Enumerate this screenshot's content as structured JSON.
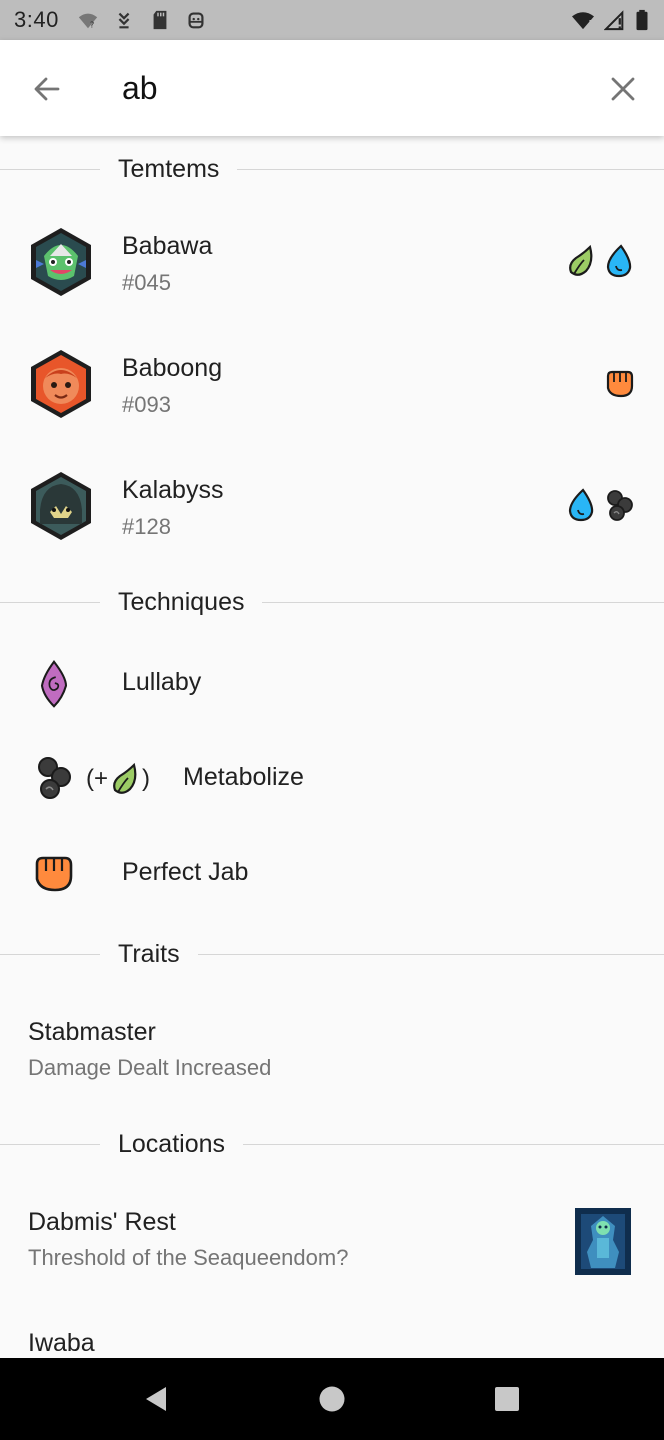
{
  "status_bar": {
    "time": "3:40"
  },
  "search": {
    "query": "ab",
    "back_icon": "arrow-left-icon",
    "clear_icon": "close-icon"
  },
  "sections": {
    "temtems": {
      "title": "Temtems"
    },
    "techniques": {
      "title": "Techniques"
    },
    "traits": {
      "title": "Traits"
    },
    "locations": {
      "title": "Locations"
    }
  },
  "temtems": [
    {
      "name": "Babawa",
      "number": "#045",
      "types": [
        "nature",
        "water"
      ],
      "avatar_color": "#3fae5a"
    },
    {
      "name": "Baboong",
      "number": "#093",
      "types": [
        "melee"
      ],
      "avatar_color": "#e8562a"
    },
    {
      "name": "Kalabyss",
      "number": "#128",
      "types": [
        "water",
        "toxic"
      ],
      "avatar_color": "#2d4a4a"
    }
  ],
  "techniques": [
    {
      "name": "Lullaby",
      "type": "mental"
    },
    {
      "name": "Metabolize",
      "type": "toxic",
      "synergy_open": "(+",
      "synergy_close": ")",
      "synergy_type": "nature"
    },
    {
      "name": "Perfect Jab",
      "type": "melee"
    }
  ],
  "traits": [
    {
      "name": "Stabmaster",
      "description": "Damage Dealt Increased"
    }
  ],
  "locations": [
    {
      "name": "Dabmis' Rest",
      "description": "Threshold of the Seaqueendom?"
    },
    {
      "name": "Iwaba",
      "description": ""
    }
  ],
  "colors": {
    "nature": "#8bc34a",
    "water": "#29b6f6",
    "melee": "#ff8a3d",
    "mental": "#b05bb0",
    "toxic": "#3b3b3b",
    "divider": "#d6d6d6",
    "secondary_text": "#757575"
  }
}
